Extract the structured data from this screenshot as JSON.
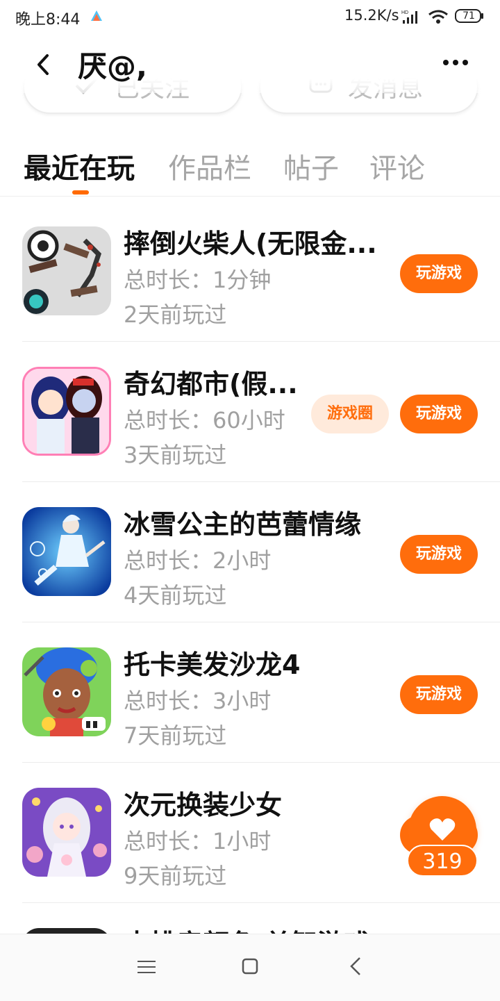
{
  "status_bar": {
    "time": "晚上8:44",
    "net_speed": "15.2K/s",
    "battery": "71"
  },
  "header": {
    "user_name": "厌@,",
    "follow_label": "已关注",
    "message_label": "发消息"
  },
  "tabs": [
    {
      "label": "最近在玩",
      "active": true
    },
    {
      "label": "作品栏",
      "active": false
    },
    {
      "label": "帖子",
      "active": false
    },
    {
      "label": "评论",
      "active": false
    }
  ],
  "games": [
    {
      "title": "摔倒火柴人(无限金...",
      "duration": "总时长：1分钟",
      "last_played": "2天前玩过",
      "play_label": "玩游戏",
      "circle_label": ""
    },
    {
      "title": "奇幻都市(假...",
      "duration": "总时长：60小时",
      "last_played": "3天前玩过",
      "play_label": "玩游戏",
      "circle_label": "游戏圈"
    },
    {
      "title": "冰雪公主的芭蕾情缘",
      "duration": "总时长：2小时",
      "last_played": "4天前玩过",
      "play_label": "玩游戏",
      "circle_label": ""
    },
    {
      "title": "托卡美发沙龙4",
      "duration": "总时长：3小时",
      "last_played": "7天前玩过",
      "play_label": "玩游戏",
      "circle_label": ""
    },
    {
      "title": "次元换装少女",
      "duration": "总时长：1小时",
      "last_played": "9天前玩过",
      "play_label": "",
      "circle_label": ""
    }
  ],
  "partial_game": {
    "title": "水排房颜色 单智游戏"
  },
  "like": {
    "count": "319"
  },
  "colors": {
    "accent": "#ff6d0c",
    "accent_light": "#ffeadb"
  }
}
